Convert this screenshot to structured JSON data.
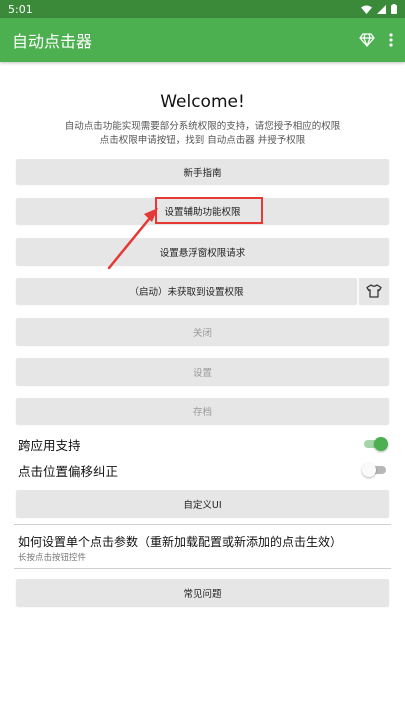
{
  "status": {
    "time": "5:01"
  },
  "appbar": {
    "title": "自动点击器",
    "accent": "#4caf50",
    "icons": [
      "diamond-icon",
      "more-vert-icon"
    ]
  },
  "welcome": {
    "title": "Welcome!",
    "desc_line1": "自动点击功能实现需要部分系统权限的支持，请您授予相应的权限",
    "desc_line2": "点击权限申请按钮，找到 自动点击器 并授予权限"
  },
  "buttons": {
    "guide": "新手指南",
    "accessibility": "设置辅助功能权限",
    "overlay": "设置悬浮窗权限请求",
    "start": "（启动）未获取到设置权限",
    "close": "关闭",
    "settings": "设置",
    "save": "存档",
    "custom_ui": "自定义UI",
    "faq": "常见问题"
  },
  "toggles": {
    "cross_app": {
      "label": "跨应用支持",
      "on": true
    },
    "offset": {
      "label": "点击位置偏移纠正",
      "on": false
    }
  },
  "section": {
    "title": "如何设置单个点击参数（重新加载配置或新添加的点击生效）",
    "subtitle": "长按点击按钮控件"
  },
  "annotation_color": "#e53935"
}
